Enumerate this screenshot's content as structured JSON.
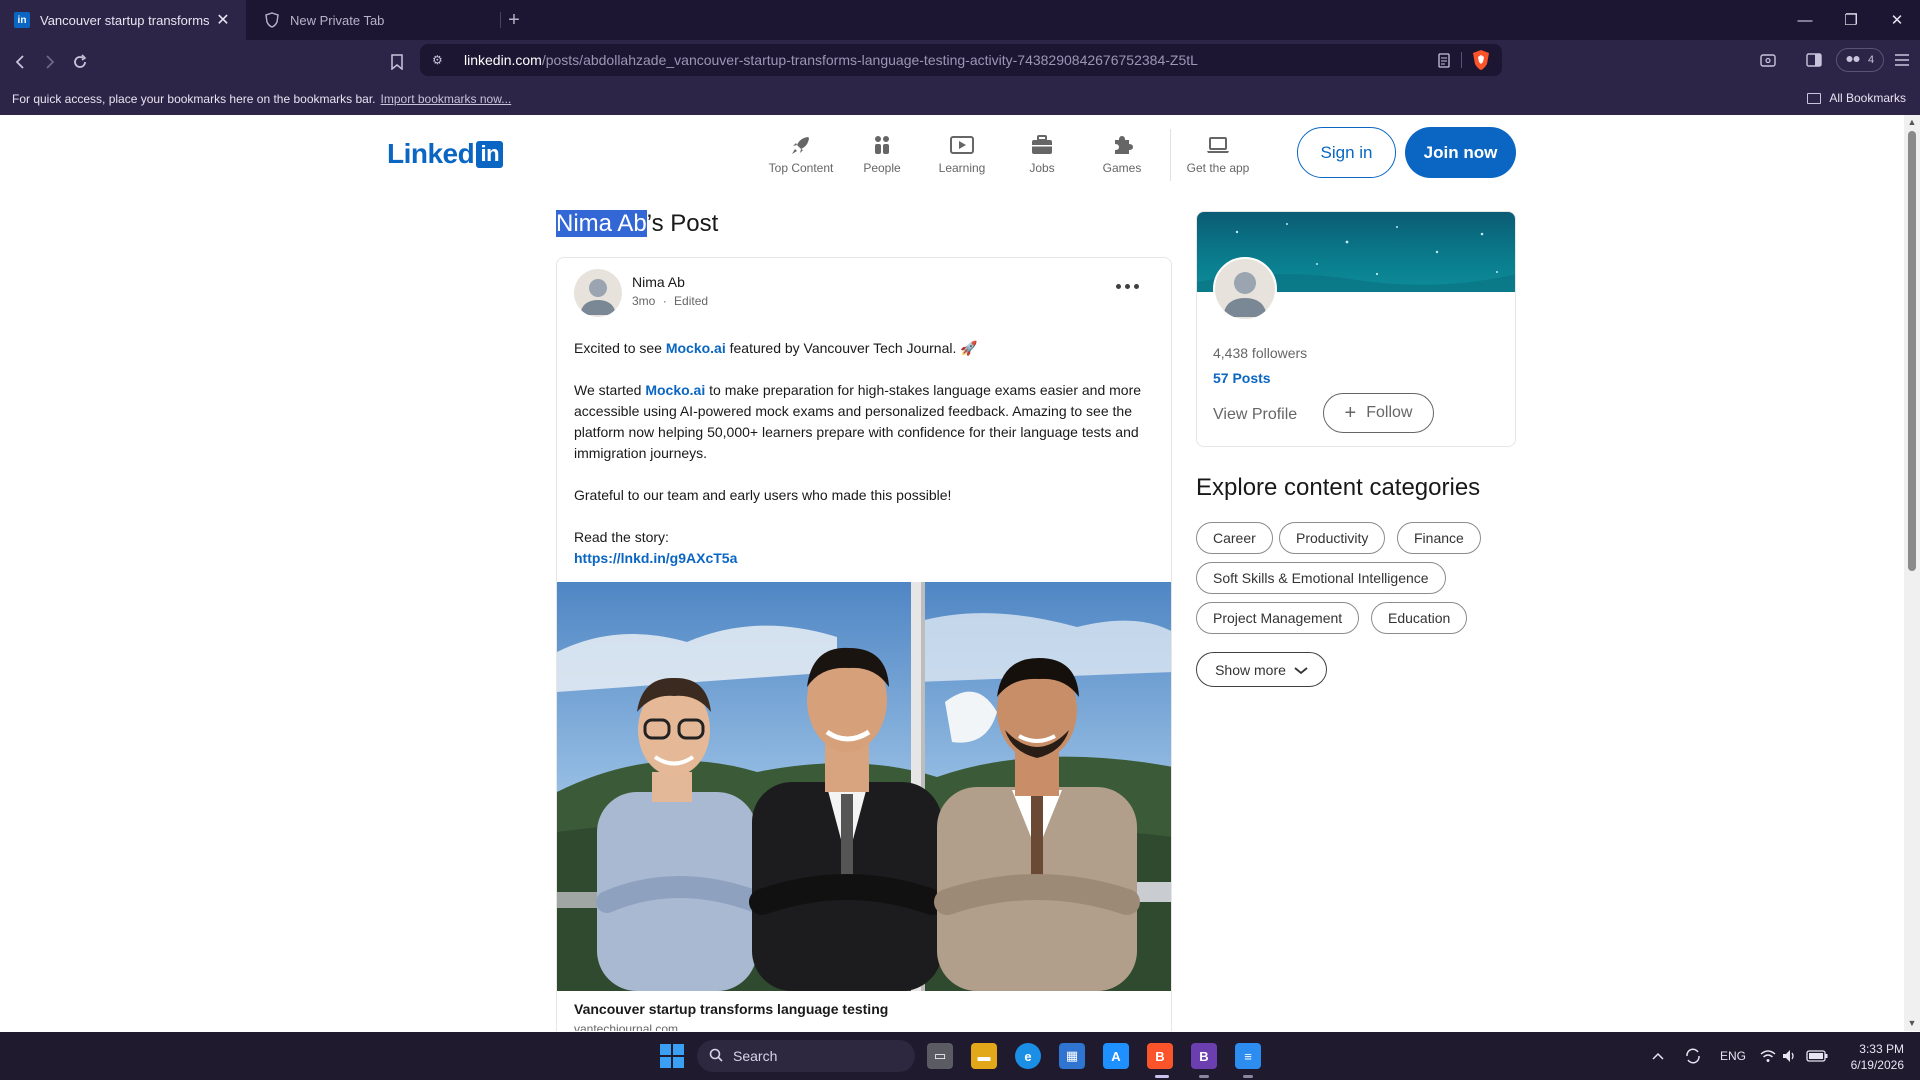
{
  "browser": {
    "tabs": [
      {
        "title": "Vancouver startup transforms language testing",
        "active": true
      },
      {
        "title": "New Private Tab",
        "active": false
      }
    ],
    "url_host": "linkedin.com",
    "url_path": "/posts/abdollahzade_vancouver-startup-transforms-language-testing-activity-7438290842676752384-Z5tL",
    "bookmarks_prompt": "For quick access, place your bookmarks here on the bookmarks bar.",
    "bookmarks_import": "Import bookmarks now...",
    "all_bookmarks": "All Bookmarks",
    "vpn_count": "4"
  },
  "header": {
    "logo_text": "Linked",
    "logo_box": "in",
    "nav": [
      {
        "label": "Top Content",
        "icon": "rocket-icon"
      },
      {
        "label": "People",
        "icon": "people-icon"
      },
      {
        "label": "Learning",
        "icon": "play-icon"
      },
      {
        "label": "Jobs",
        "icon": "briefcase-icon"
      },
      {
        "label": "Games",
        "icon": "puzzle-icon"
      },
      {
        "label": "Get the app",
        "icon": "laptop-icon"
      }
    ],
    "sign_in": "Sign in",
    "join_now": "Join now"
  },
  "post": {
    "heading_selected": "Nima Ab",
    "heading_rest": "’s Post",
    "author": "Nima Ab",
    "time": "3mo",
    "edited": "Edited",
    "p1_before": "Excited to see ",
    "p1_link": "Mocko.ai",
    "p1_after": " featured by Vancouver Tech Journal. 🚀",
    "p2_before": "We started ",
    "p2_link": "Mocko.ai",
    "p2_after": " to make preparation for high-stakes language exams easier and more accessible using AI-powered mock exams and personalized feedback. Amazing to see the platform now helping 50,000+ learners prepare with confidence for their language tests and immigration journeys.",
    "p3": "Grateful to our team and early users who made this possible!",
    "p4_label": "Read the story:",
    "p4_link": "https://lnkd.in/g9AXcT5a",
    "article_title": "Vancouver startup transforms language testing",
    "article_source": "vantechjournal.com"
  },
  "profile": {
    "followers": "4,438 followers",
    "posts": "57 Posts",
    "view_profile": "View Profile",
    "follow": "Follow"
  },
  "explore": {
    "title": "Explore content categories",
    "chips": [
      "Career",
      "Productivity",
      "Finance",
      "Soft Skills & Emotional Intelligence",
      "Project Management",
      "Education"
    ],
    "show_more": "Show more"
  },
  "taskbar": {
    "search_placeholder": "Search",
    "language": "ENG",
    "time": "3:33 PM",
    "date": "6/19/2026"
  },
  "colors": {
    "linkedin_blue": "#0a66c2",
    "browser_dark": "#1c1633",
    "browser_toolbar": "#2d2547",
    "selection": "#3367d6"
  }
}
